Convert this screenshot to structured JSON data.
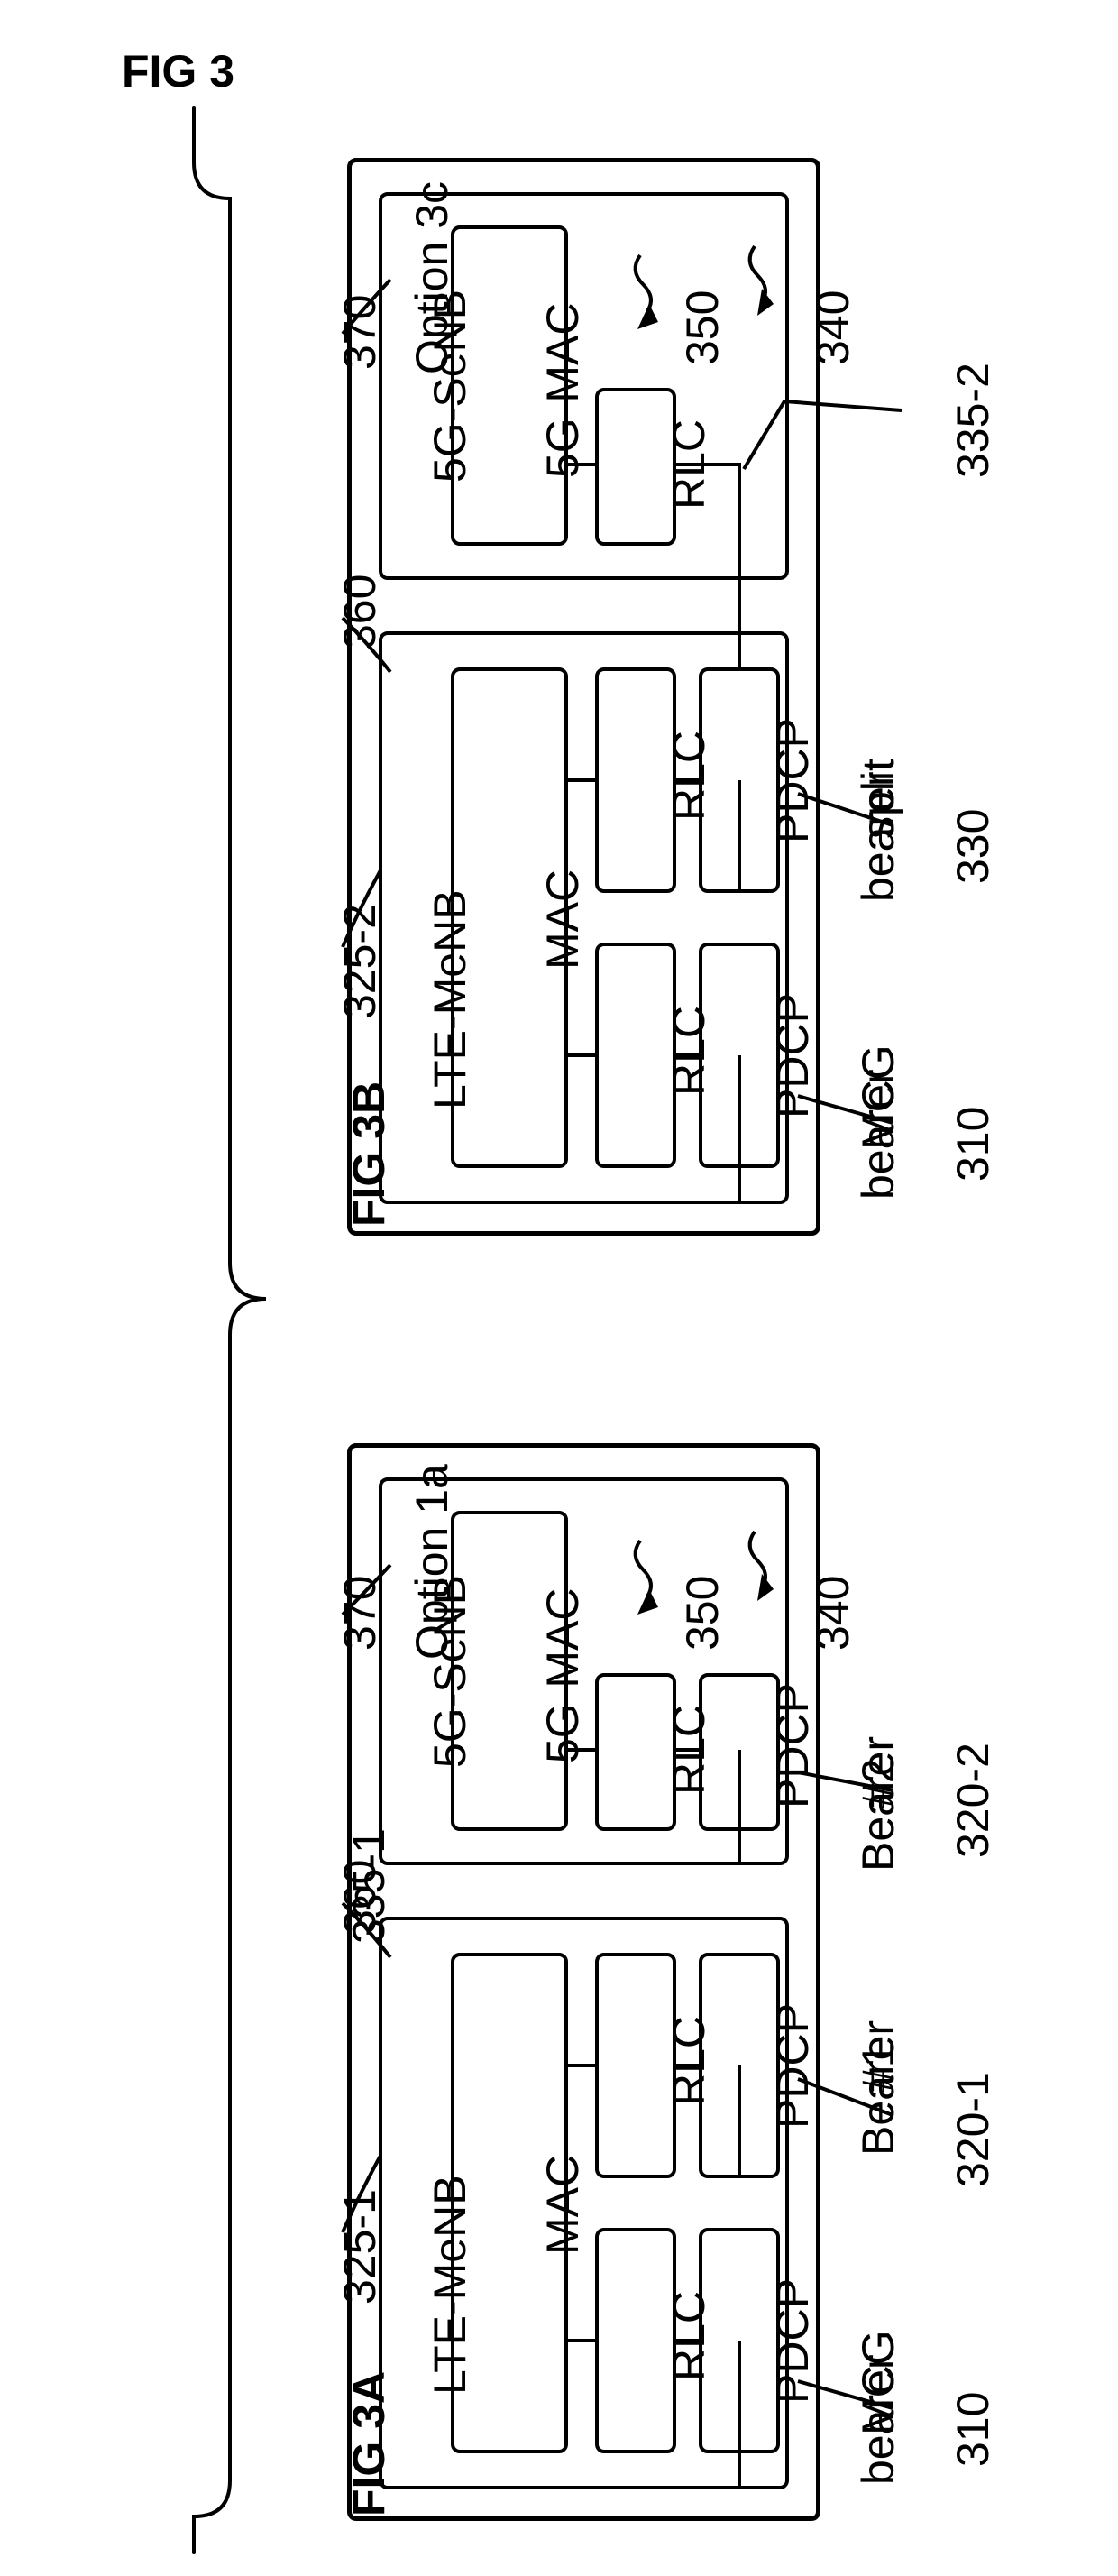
{
  "fig": {
    "main": "FIG 3",
    "a": "FIG 3A",
    "b": "FIG 3B"
  },
  "refs": {
    "r310": "310",
    "r320_1": "320-1",
    "r320_2": "320-2",
    "r325_1": "325-1",
    "r325_2": "325-2",
    "r330": "330",
    "r335_1": "335-1",
    "r335_2": "335-2",
    "r340": "340",
    "r350": "350",
    "r360": "360",
    "r370": "370"
  },
  "text": {
    "mcg": "MCG",
    "bearer": "bearer",
    "bearer1": "Bearer",
    "hash1": "#1",
    "hash2": "#2",
    "split": "split",
    "option1a": "Option 1a",
    "option3c": "Option 3c",
    "pdcp": "PDCP",
    "rlc": "RLC",
    "mac": "MAC",
    "g5mac": "5G-MAC",
    "lteMenb": "LTE-MeNB",
    "g5senb": "5G-SeNB"
  }
}
